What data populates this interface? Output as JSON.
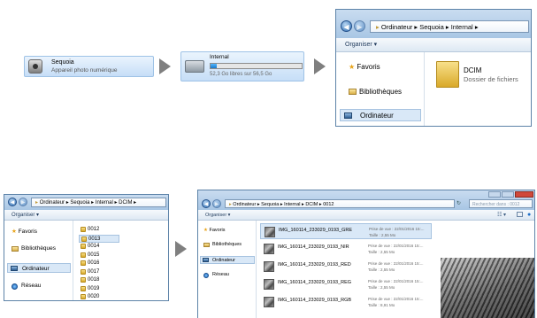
{
  "step1": {
    "device_name": "Sequoia",
    "device_type": "Appareil photo numérique"
  },
  "step2": {
    "drive_name": "Internal",
    "free_space": "52,3 Go libres sur 56,5 Go",
    "used_fraction": 0.07
  },
  "explorer_a": {
    "path": [
      "Ordinateur",
      "Sequoia",
      "Internal"
    ],
    "toolbar_organize": "Organiser ▾",
    "nav": [
      "Favoris",
      "Bibliothèques",
      "Ordinateur"
    ],
    "folder": {
      "name": "DCIM",
      "type": "Dossier de fichiers"
    }
  },
  "explorer_b": {
    "path": [
      "Ordinateur",
      "Sequoia",
      "Internal",
      "DCIM"
    ],
    "toolbar_organize": "Organiser ▾",
    "nav": [
      "Favoris",
      "Bibliothèques",
      "Ordinateur",
      "Réseau"
    ],
    "folders": [
      "0012",
      "0013",
      "0014",
      "0015",
      "0016",
      "0017",
      "0018",
      "0019",
      "0020"
    ],
    "selected_folder": "0013"
  },
  "explorer_c": {
    "path": [
      "Ordinateur",
      "Sequoia",
      "Internal",
      "DCIM",
      "0012"
    ],
    "search_placeholder": "Rechercher dans : 0012",
    "toolbar_organize": "Organiser ▾",
    "nav": [
      "Favoris",
      "Bibliothèques",
      "Ordinateur",
      "Réseau"
    ],
    "files": [
      {
        "name": "IMG_160114_233029_0193_GRE",
        "date": "Prise de vue : 22/01/2016 15:...",
        "size": "Taille : 2,55 Mo"
      },
      {
        "name": "IMG_160114_233029_0193_NIR",
        "date": "Prise de vue : 22/01/2016 15:...",
        "size": "Taille : 2,55 Mo"
      },
      {
        "name": "IMG_160114_233029_0193_RED",
        "date": "Prise de vue : 22/01/2016 15:...",
        "size": "Taille : 2,55 Mo"
      },
      {
        "name": "IMG_160114_233029_0193_REG",
        "date": "Prise de vue : 22/01/2016 15:...",
        "size": "Taille : 2,55 Mo"
      },
      {
        "name": "IMG_160114_233029_0193_RGB",
        "date": "Prise de vue : 22/01/2016 15:...",
        "size": "Taille : 8,91 Mo"
      }
    ]
  },
  "colors": {
    "accent": "#2f6eb3",
    "selection": "#d9e8f7",
    "arrow": "#7f7f7f"
  }
}
